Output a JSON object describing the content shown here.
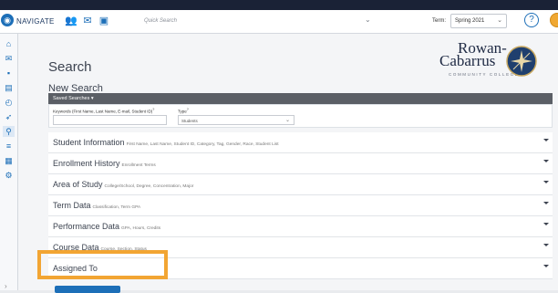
{
  "topbar": {
    "app_name": "NAVIGATE",
    "quick_search_placeholder": "Quick Search",
    "term_label": "Term:",
    "term_value": "Spring 2021",
    "help_icon": "help-circle-icon"
  },
  "sidebar": {
    "icons": [
      "home-icon",
      "mail-icon",
      "calendar-icon",
      "reports-icon",
      "clock-icon",
      "pin-icon",
      "search-icon",
      "list-icon",
      "lists-icon",
      "settings-icon"
    ],
    "active": "search-icon"
  },
  "page": {
    "title": "Search",
    "section_title": "New Search",
    "saved_searches_label": "Saved Searches"
  },
  "brand": {
    "line1": "Rowan-",
    "line2": "Cabarrus",
    "line3": "COMMUNITY COLLEGE"
  },
  "form": {
    "keywords_label": "Keywords (First Name, Last Name, E-mail, Student ID)",
    "keywords_value": "",
    "type_label": "Type",
    "type_value": "Students"
  },
  "accordion": [
    {
      "title": "Student Information",
      "subtitle": "First Name, Last Name, Student ID, Category, Tag, Gender, Race, Student List"
    },
    {
      "title": "Enrollment History",
      "subtitle": "Enrollment Terms"
    },
    {
      "title": "Area of Study",
      "subtitle": "College/School, Degree, Concentration, Major"
    },
    {
      "title": "Term Data",
      "subtitle": "Classification, Term GPA"
    },
    {
      "title": "Performance Data",
      "subtitle": "GPA, Hours, Credits"
    },
    {
      "title": "Course Data",
      "subtitle": "Course, Section, Status"
    },
    {
      "title": "Assigned To",
      "subtitle": ""
    }
  ],
  "colors": {
    "accent": "#1d6fb8",
    "highlight": "#f2a533",
    "saved_bar": "#5b5f66"
  }
}
